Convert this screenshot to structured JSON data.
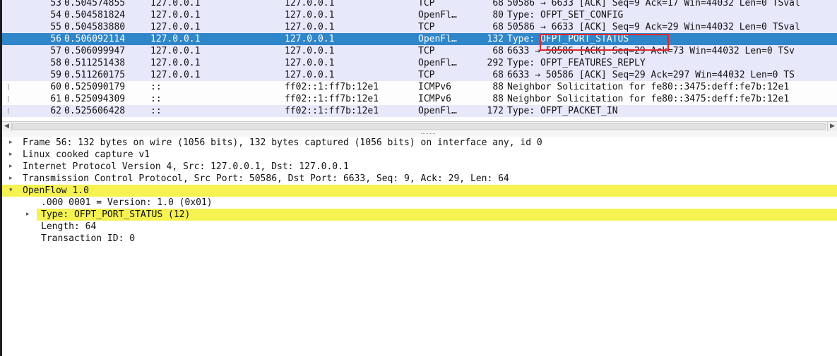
{
  "packets": [
    {
      "no": "53",
      "time": "0.504574855",
      "source": "127.0.0.1",
      "destination": "127.0.0.1",
      "protocol": "TCP",
      "length": "68",
      "info": "50586 → 6633 [ACK] Seq=9 Ack=17 Win=44032 Len=0 TSval"
    },
    {
      "no": "54",
      "time": "0.504581824",
      "source": "127.0.0.1",
      "destination": "127.0.0.1",
      "protocol": "OpenFl…",
      "length": "80",
      "info": "Type: OFPT_SET_CONFIG"
    },
    {
      "no": "55",
      "time": "0.504583880",
      "source": "127.0.0.1",
      "destination": "127.0.0.1",
      "protocol": "TCP",
      "length": "68",
      "info": "50586 → 6633 [ACK] Seq=9 Ack=29 Win=44032 Len=0 TSval"
    },
    {
      "no": "56",
      "time": "0.506092114",
      "source": "127.0.0.1",
      "destination": "127.0.0.1",
      "protocol": "OpenFl…",
      "length": "132",
      "info": "Type: OFPT_PORT_STATUS"
    },
    {
      "no": "57",
      "time": "0.506099947",
      "source": "127.0.0.1",
      "destination": "127.0.0.1",
      "protocol": "TCP",
      "length": "68",
      "info": "6633 → 50586 [ACK] Seq=29 Ack=73 Win=44032 Len=0 TSv"
    },
    {
      "no": "58",
      "time": "0.511251438",
      "source": "127.0.0.1",
      "destination": "127.0.0.1",
      "protocol": "OpenFl…",
      "length": "292",
      "info": "Type: OFPT_FEATURES_REPLY"
    },
    {
      "no": "59",
      "time": "0.511260175",
      "source": "127.0.0.1",
      "destination": "127.0.0.1",
      "protocol": "TCP",
      "length": "68",
      "info": "6633 → 50586 [ACK] Seq=29 Ack=297 Win=44032 Len=0 TS"
    },
    {
      "no": "60",
      "time": "0.525090179",
      "source": "::",
      "destination": "ff02::1:ff7b:12e1",
      "protocol": "ICMPv6",
      "length": "88",
      "info": "Neighbor Solicitation for fe80::3475:deff:fe7b:12e1"
    },
    {
      "no": "61",
      "time": "0.525094309",
      "source": "::",
      "destination": "ff02::1:ff7b:12e1",
      "protocol": "ICMPv6",
      "length": "88",
      "info": "Neighbor Solicitation for fe80::3475:deff:fe7b:12e1"
    },
    {
      "no": "62",
      "time": "0.525606428",
      "source": "::",
      "destination": "ff02::1:ff7b:12e1",
      "protocol": "OpenFl…",
      "length": "172",
      "info": "Type: OFPT_PACKET_IN"
    }
  ],
  "selected_packet": "56",
  "details": [
    {
      "text": "Frame 56: 132 bytes on wire (1056 bits), 132 bytes captured (1056 bits) on interface any, id 0",
      "expander": "▸"
    },
    {
      "text": "Linux cooked capture v1",
      "expander": "▸"
    },
    {
      "text": "Internet Protocol Version 4, Src: 127.0.0.1, Dst: 127.0.0.1",
      "expander": "▸"
    },
    {
      "text": "Transmission Control Protocol, Src Port: 50586, Dst Port: 6633, Seq: 9, Ack: 29, Len: 64",
      "expander": "▸"
    },
    {
      "text": "OpenFlow 1.0",
      "expander": "▾"
    },
    {
      "text": ".000 0001 = Version: 1.0 (0x01)",
      "expander": ""
    },
    {
      "text": "Type: OFPT_PORT_STATUS (12)",
      "expander": "▸"
    },
    {
      "text": "Length: 64",
      "expander": ""
    },
    {
      "text": "Transaction ID: 0",
      "expander": ""
    }
  ],
  "scroll": {
    "left_arrow": "◀",
    "right_arrow": "▶"
  },
  "colors": {
    "selection": "#2f86c9",
    "tcp_row": "#e8e8fb",
    "icmp_row": "#fdfdfd",
    "detail_highlight": "#f5f252",
    "annotation_box": "#e0262c"
  }
}
